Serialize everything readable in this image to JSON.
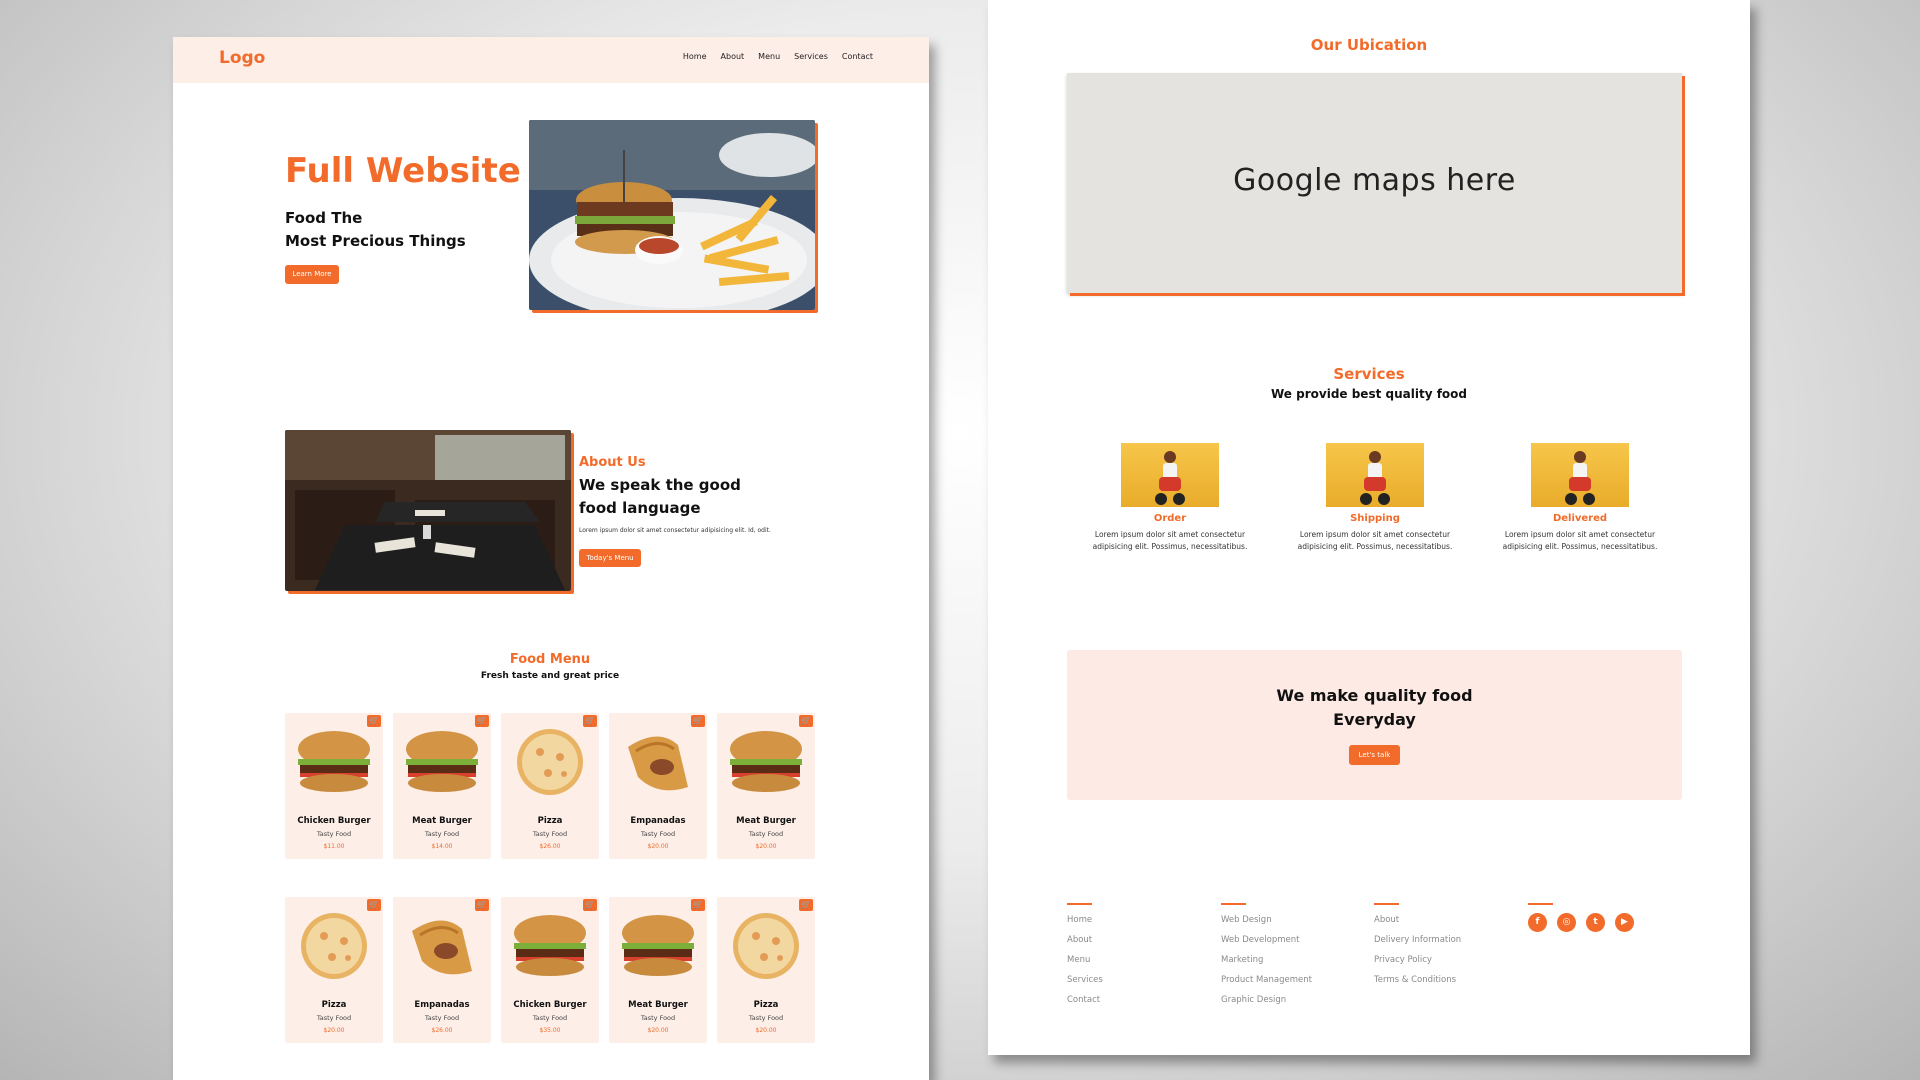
{
  "left_page": {
    "nav": {
      "logo": "Logo",
      "links": [
        "Home",
        "About",
        "Menu",
        "Services",
        "Contact"
      ]
    },
    "hero": {
      "title": "Full Website",
      "subtitle_line1": "Food The",
      "subtitle_line2": "Most Precious Things",
      "button": "Learn More"
    },
    "about": {
      "kicker": "About Us",
      "title_line1": "We speak the good",
      "title_line2": "food language",
      "text": "Lorem ipsum dolor sit amet consectetur adipisicing elit. Id, odit.",
      "button": "Today's Menu"
    },
    "food_menu": {
      "kicker": "Food Menu",
      "subtitle": "Fresh taste and great price",
      "items": [
        {
          "name": "Chicken Burger",
          "tag": "Tasty Food",
          "price": "$11.00",
          "icon": "burger"
        },
        {
          "name": "Meat Burger",
          "tag": "Tasty Food",
          "price": "$14.00",
          "icon": "burger"
        },
        {
          "name": "Pizza",
          "tag": "Tasty Food",
          "price": "$26.00",
          "icon": "pizza"
        },
        {
          "name": "Empanadas",
          "tag": "Tasty Food",
          "price": "$20.00",
          "icon": "empanada"
        },
        {
          "name": "Meat Burger",
          "tag": "Tasty Food",
          "price": "$20.00",
          "icon": "burger"
        },
        {
          "name": "Pizza",
          "tag": "Tasty Food",
          "price": "$20.00",
          "icon": "pizza"
        },
        {
          "name": "Empanadas",
          "tag": "Tasty Food",
          "price": "$26.00",
          "icon": "empanada"
        },
        {
          "name": "Chicken Burger",
          "tag": "Tasty Food",
          "price": "$35.00",
          "icon": "burger"
        },
        {
          "name": "Meat Burger",
          "tag": "Tasty Food",
          "price": "$20.00",
          "icon": "burger"
        },
        {
          "name": "Pizza",
          "tag": "Tasty Food",
          "price": "$20.00",
          "icon": "pizza"
        }
      ]
    }
  },
  "right_page": {
    "location": {
      "title": "Our Ubication",
      "map_placeholder": "Google maps here"
    },
    "services": {
      "kicker": "Services",
      "subtitle": "We provide best quality food",
      "items": [
        {
          "title": "Order",
          "desc_line1": "Lorem ipsum dolor sit amet consectetur",
          "desc_line2": "adipisicing elit. Possimus, necessitatibus."
        },
        {
          "title": "Shipping",
          "desc_line1": "Lorem ipsum dolor sit amet consectetur",
          "desc_line2": "adipisicing elit. Possimus, necessitatibus."
        },
        {
          "title": "Delivered",
          "desc_line1": "Lorem ipsum dolor sit amet consectetur",
          "desc_line2": "adipisicing elit. Possimus, necessitatibus."
        }
      ]
    },
    "cta": {
      "line1": "We make quality food",
      "line2": "Everyday",
      "button": "Let's talk"
    },
    "footer": {
      "col1": [
        "Home",
        "About",
        "Menu",
        "Services",
        "Contact"
      ],
      "col2": [
        "Web Design",
        "Web Development",
        "Marketing",
        "Product Management",
        "Graphic Design"
      ],
      "col3": [
        "About",
        "Delivery Information",
        "Privacy Policy",
        "Terms & Conditions"
      ],
      "socials": [
        {
          "icon": "facebook-icon",
          "glyph": "f"
        },
        {
          "icon": "instagram-icon",
          "glyph": "◎"
        },
        {
          "icon": "twitter-icon",
          "glyph": "t"
        },
        {
          "icon": "youtube-icon",
          "glyph": "▶"
        }
      ]
    }
  },
  "colors": {
    "accent": "#f26b2a",
    "soft_bg": "#fdeee8",
    "map_bg": "#e5e3df"
  }
}
